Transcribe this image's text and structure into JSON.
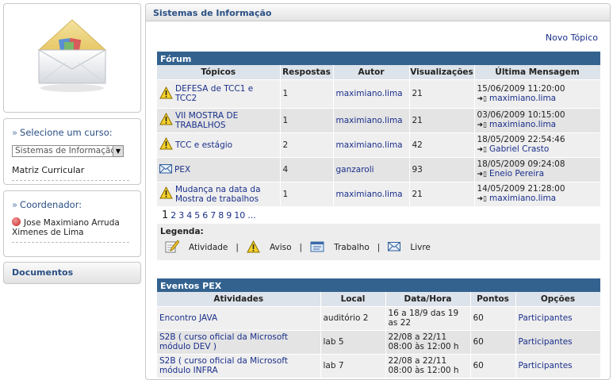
{
  "sidebar": {
    "course_title": "Selecione um curso:",
    "course_select": "Sistemas de Informação",
    "curriculum_link": "Matriz Curricular",
    "coordinator_title": "Coordenador:",
    "coordinator_name": "Jose Maximiano Arruda Ximenes de Lima",
    "documents": "Documentos"
  },
  "main": {
    "header": "Sistemas de Informação",
    "new_topic": "Novo Tópico"
  },
  "forum": {
    "title": "Fórum",
    "columns": [
      "Tópicos",
      "Respostas",
      "Autor",
      "Visualizações",
      "Última Mensagem"
    ],
    "rows": [
      {
        "icon": "warning-icon",
        "topic": "DEFESA de TCC1 e TCC2",
        "replies": "1",
        "author": "maximiano.lima",
        "views": "21",
        "last_date": "15/06/2009 11:20:00",
        "last_user": "maximiano.lima"
      },
      {
        "icon": "warning-icon",
        "topic": "VII MOSTRA DE TRABALHOS",
        "replies": "1",
        "author": "maximiano.lima",
        "views": "21",
        "last_date": "03/06/2009 10:15:00",
        "last_user": "maximiano.lima"
      },
      {
        "icon": "warning-icon",
        "topic": "TCC e estágio",
        "replies": "2",
        "author": "maximiano.lima",
        "views": "42",
        "last_date": "18/05/2009 22:54:46",
        "last_user": "Gabriel Crasto"
      },
      {
        "icon": "mail-icon",
        "topic": "PEX",
        "replies": "4",
        "author": "ganzaroli",
        "views": "93",
        "last_date": "18/05/2009 09:24:08",
        "last_user": "Eneio Pereira"
      },
      {
        "icon": "warning-icon",
        "topic": "Mudança na data da Mostra de trabalhos",
        "replies": "1",
        "author": "maximiano.lima",
        "views": "21",
        "last_date": "14/05/2009 21:28:00",
        "last_user": "maximiano.lima"
      }
    ],
    "pages": [
      "1",
      "2",
      "3",
      "4",
      "5",
      "6",
      "7",
      "8",
      "9",
      "10",
      "..."
    ],
    "legend_title": "Legenda:",
    "legend": [
      {
        "icon": "activity-icon",
        "label": "Atividade"
      },
      {
        "icon": "warning-icon",
        "label": "Aviso"
      },
      {
        "icon": "work-icon",
        "label": "Trabalho"
      },
      {
        "icon": "mail-icon",
        "label": "Livre"
      }
    ]
  },
  "events": {
    "title": "Eventos PEX",
    "columns": [
      "Atividades",
      "Local",
      "Data/Hora",
      "Pontos",
      "Opções"
    ],
    "rows": [
      {
        "activity": "Encontro JAVA",
        "place": "auditório 2",
        "datetime": "16 a 18/9 das 19 as 22",
        "points": "60",
        "option": "Participantes"
      },
      {
        "activity": "S2B ( curso oficial da Microsoft módulo DEV )",
        "place": "lab 5",
        "datetime": "22/08 a 22/11 08:00 às 12:00 h",
        "points": "60",
        "option": "Participantes"
      },
      {
        "activity": "S2B ( curso oficial da Microsoft módulo INFRA",
        "place": "lab 7",
        "datetime": "22/08 a 22/11 08:00 às 12:00 h",
        "points": "60",
        "option": "Participantes"
      }
    ]
  }
}
